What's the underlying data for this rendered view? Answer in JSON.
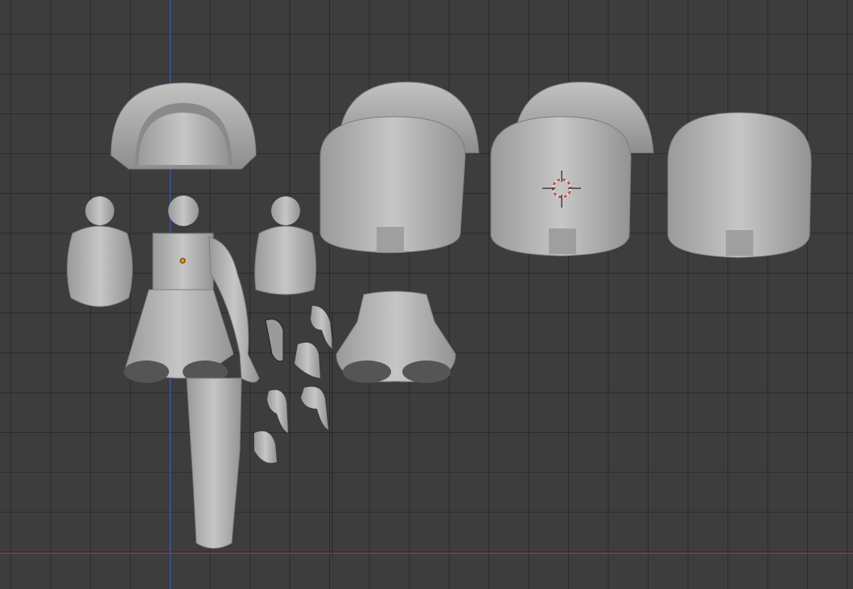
{
  "viewport": {
    "background": "#3d3d3d",
    "grid_color": "#2f2f2f",
    "x_axis_color": "#b83a3a",
    "y_axis_color": "#3c5fb8",
    "mesh_color": "#a8a8a8",
    "cursor_icon": "3d-cursor-icon",
    "origin_icon": "object-origin-icon"
  }
}
